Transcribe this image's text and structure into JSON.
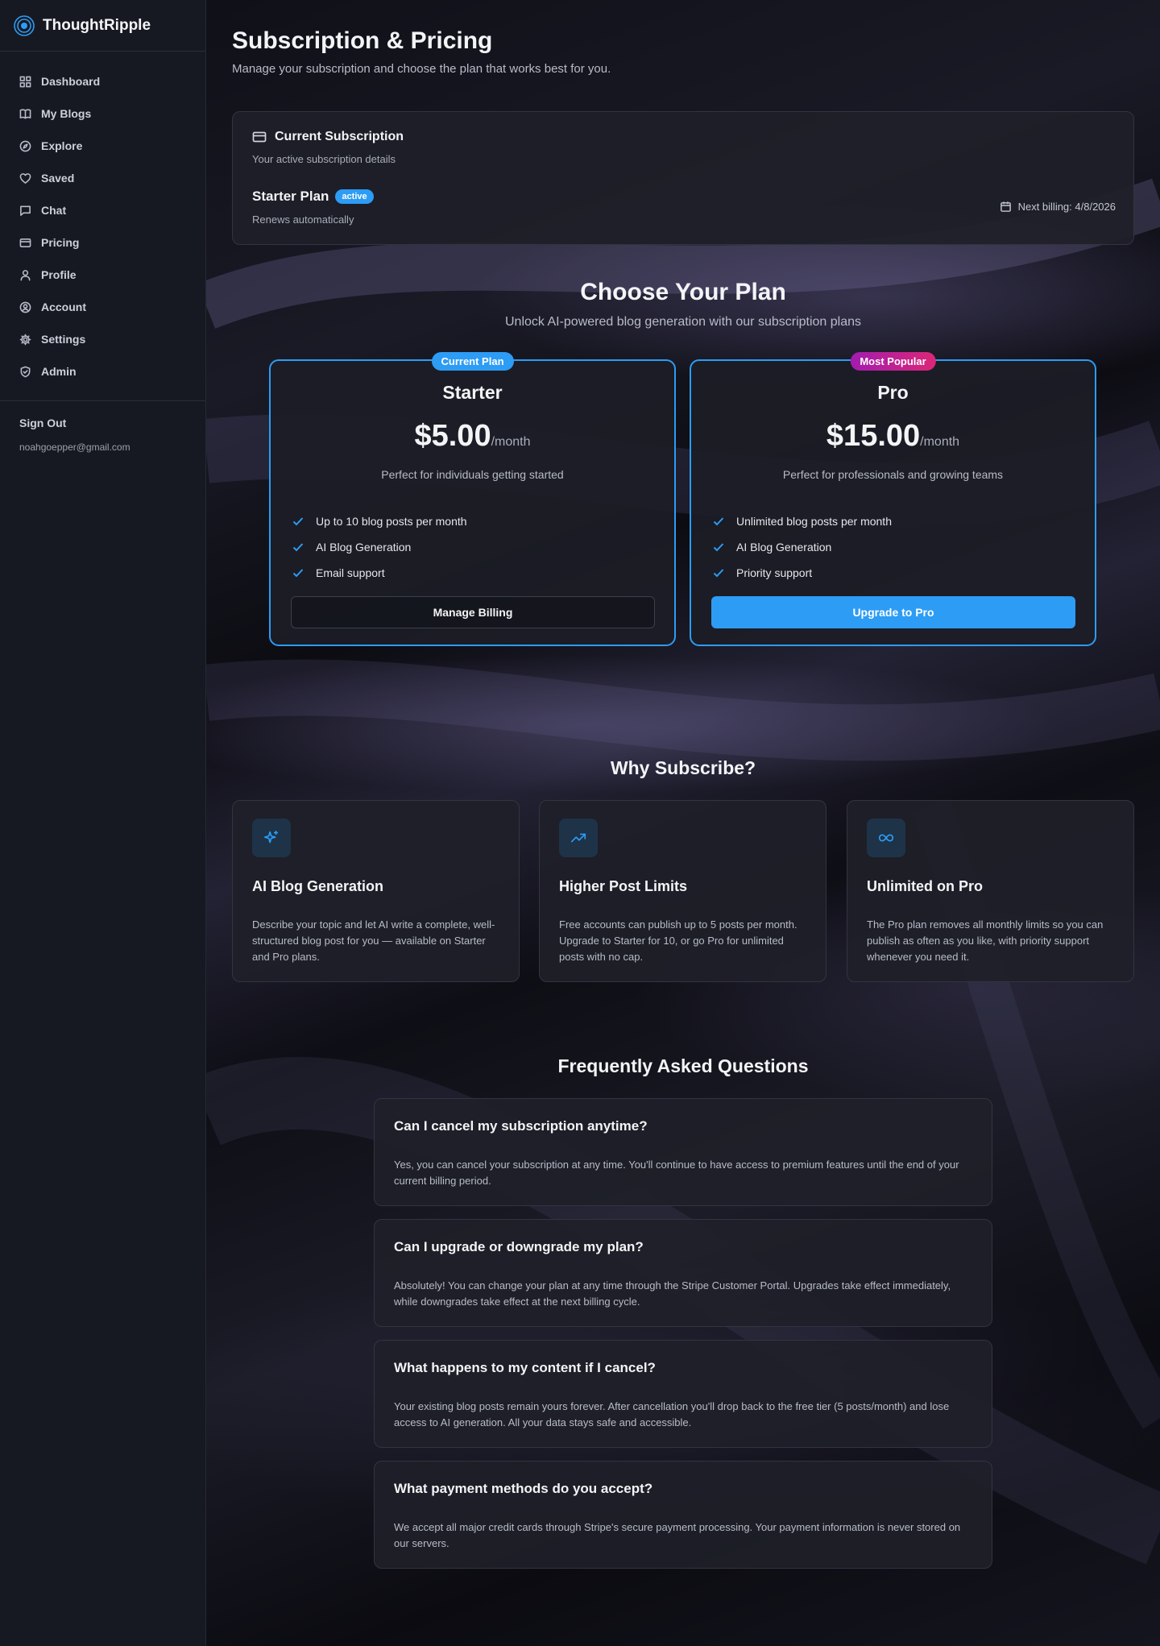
{
  "brand": {
    "name": "ThoughtRipple",
    "logo_icon": "ripple-logo-icon"
  },
  "sidebar": {
    "items": [
      {
        "label": "Dashboard",
        "icon": "grid-icon"
      },
      {
        "label": "My Blogs",
        "icon": "book-icon"
      },
      {
        "label": "Explore",
        "icon": "compass-icon"
      },
      {
        "label": "Saved",
        "icon": "heart-icon"
      },
      {
        "label": "Chat",
        "icon": "message-icon"
      },
      {
        "label": "Pricing",
        "icon": "credit-card-icon"
      },
      {
        "label": "Profile",
        "icon": "user-icon"
      },
      {
        "label": "Account",
        "icon": "user-circle-icon"
      },
      {
        "label": "Settings",
        "icon": "gear-icon"
      },
      {
        "label": "Admin",
        "icon": "shield-icon"
      }
    ],
    "sign_out": "Sign Out",
    "email": "noahgoepper@gmail.com"
  },
  "header": {
    "title": "Subscription & Pricing",
    "subtitle": "Manage your subscription and choose the plan that works best for you."
  },
  "current_subscription": {
    "title": "Current Subscription",
    "description": "Your active subscription details",
    "plan_name": "Starter Plan",
    "status": "active",
    "renewal": "Renews automatically",
    "next_billing": "Next billing: 4/8/2026"
  },
  "plans_section": {
    "title": "Choose Your Plan",
    "subtitle": "Unlock AI-powered blog generation with our subscription plans"
  },
  "plans": [
    {
      "tag": "Current Plan",
      "name": "Starter",
      "price": "$5.00",
      "period": "/month",
      "description": "Perfect for individuals getting started",
      "features": [
        "Up to 10 blog posts per month",
        "AI Blog Generation",
        "Email support"
      ],
      "button": "Manage Billing"
    },
    {
      "tag": "Most Popular",
      "name": "Pro",
      "price": "$15.00",
      "period": "/month",
      "description": "Perfect for professionals and growing teams",
      "features": [
        "Unlimited blog posts per month",
        "AI Blog Generation",
        "Priority support"
      ],
      "button": "Upgrade to Pro"
    }
  ],
  "why": {
    "title": "Why Subscribe?",
    "cards": [
      {
        "icon": "sparkles-icon",
        "title": "AI Blog Generation",
        "text": "Describe your topic and let AI write a complete, well-structured blog post for you — available on Starter and Pro plans."
      },
      {
        "icon": "trending-up-icon",
        "title": "Higher Post Limits",
        "text": "Free accounts can publish up to 5 posts per month. Upgrade to Starter for 10, or go Pro for unlimited posts with no cap."
      },
      {
        "icon": "infinity-icon",
        "title": "Unlimited on Pro",
        "text": "The Pro plan removes all monthly limits so you can publish as often as you like, with priority support whenever you need it."
      }
    ]
  },
  "faq": {
    "title": "Frequently Asked Questions",
    "items": [
      {
        "q": "Can I cancel my subscription anytime?",
        "a": "Yes, you can cancel your subscription at any time. You'll continue to have access to premium features until the end of your current billing period."
      },
      {
        "q": "Can I upgrade or downgrade my plan?",
        "a": "Absolutely! You can change your plan at any time through the Stripe Customer Portal. Upgrades take effect immediately, while downgrades take effect at the next billing cycle."
      },
      {
        "q": "What happens to my content if I cancel?",
        "a": "Your existing blog posts remain yours forever. After cancellation you'll drop back to the free tier (5 posts/month) and lose access to AI generation. All your data stays safe and accessible."
      },
      {
        "q": "What payment methods do you accept?",
        "a": "We accept all major credit cards through Stripe's secure payment processing. Your payment information is never stored on our servers."
      }
    ]
  },
  "colors": {
    "accent": "#2d9cf5",
    "popular_gradient_start": "#a21caf",
    "popular_gradient_end": "#db2777",
    "sidebar_bg": "#171922",
    "page_bg": "#0d0e14"
  }
}
